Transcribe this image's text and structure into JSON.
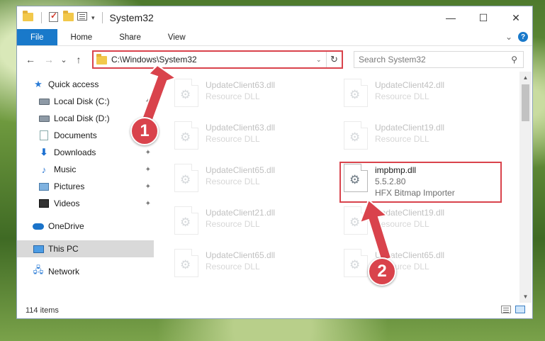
{
  "window": {
    "title": "System32"
  },
  "title_controls": {
    "minimize": "—",
    "maximize": "☐",
    "close": "✕"
  },
  "ribbon": {
    "tabs": [
      "File",
      "Home",
      "Share",
      "View"
    ],
    "expand_icon": "⌄",
    "help_icon": "?"
  },
  "nav": {
    "back": "←",
    "forward": "→",
    "recent": "⌄",
    "up": "↑",
    "address": "C:\\Windows\\System32",
    "address_dropdown": "⌄",
    "refresh": "↻",
    "search_placeholder": "Search System32",
    "search_icon": "⚲"
  },
  "sidebar": {
    "items": [
      {
        "label": "Quick access",
        "icon": "star-icon"
      },
      {
        "label": "Local Disk (C:)",
        "icon": "drive-icon",
        "pinned": true
      },
      {
        "label": "Local Disk (D:)",
        "icon": "drive-icon"
      },
      {
        "label": "Documents",
        "icon": "documents-icon",
        "pinned": true
      },
      {
        "label": "Downloads",
        "icon": "downloads-icon",
        "pinned": true
      },
      {
        "label": "Music",
        "icon": "music-icon",
        "pinned": true
      },
      {
        "label": "Pictures",
        "icon": "pictures-icon",
        "pinned": true
      },
      {
        "label": "Videos",
        "icon": "videos-icon",
        "pinned": true
      },
      {
        "label": "OneDrive",
        "icon": "onedrive-icon"
      },
      {
        "label": "This PC",
        "icon": "this-pc-icon",
        "selected": true
      },
      {
        "label": "Network",
        "icon": "network-icon"
      }
    ],
    "pin_glyph": "📌"
  },
  "files": [
    {
      "name": "UpdateClient63.dll",
      "sub": "Resource DLL"
    },
    {
      "name": "UpdateClient42.dll",
      "sub": "Resource DLL"
    },
    {
      "name": "UpdateClient63.dll",
      "sub": "Resource DLL"
    },
    {
      "name": "UpdateClient19.dll",
      "sub": "Resource DLL"
    },
    {
      "name": "UpdateClient65.dll",
      "sub": "Resource DLL"
    },
    {
      "name": "impbmp.dll",
      "version": "5.5.2.80",
      "description": "HFX Bitmap Importer",
      "highlighted": true
    },
    {
      "name": "UpdateClient21.dll",
      "sub": "Resource DLL"
    },
    {
      "name": "UpdateClient19.dll",
      "sub": "Resource DLL"
    },
    {
      "name": "UpdateClient65.dll",
      "sub": "Resource DLL"
    },
    {
      "name": "UpdateClient65.dll",
      "sub": "Resource DLL"
    }
  ],
  "scroll": {
    "up": "▲",
    "down": "▼"
  },
  "status": {
    "item_count": "114 items"
  },
  "annotations": {
    "step1": "1",
    "step2": "2",
    "color": "#d9434c"
  }
}
